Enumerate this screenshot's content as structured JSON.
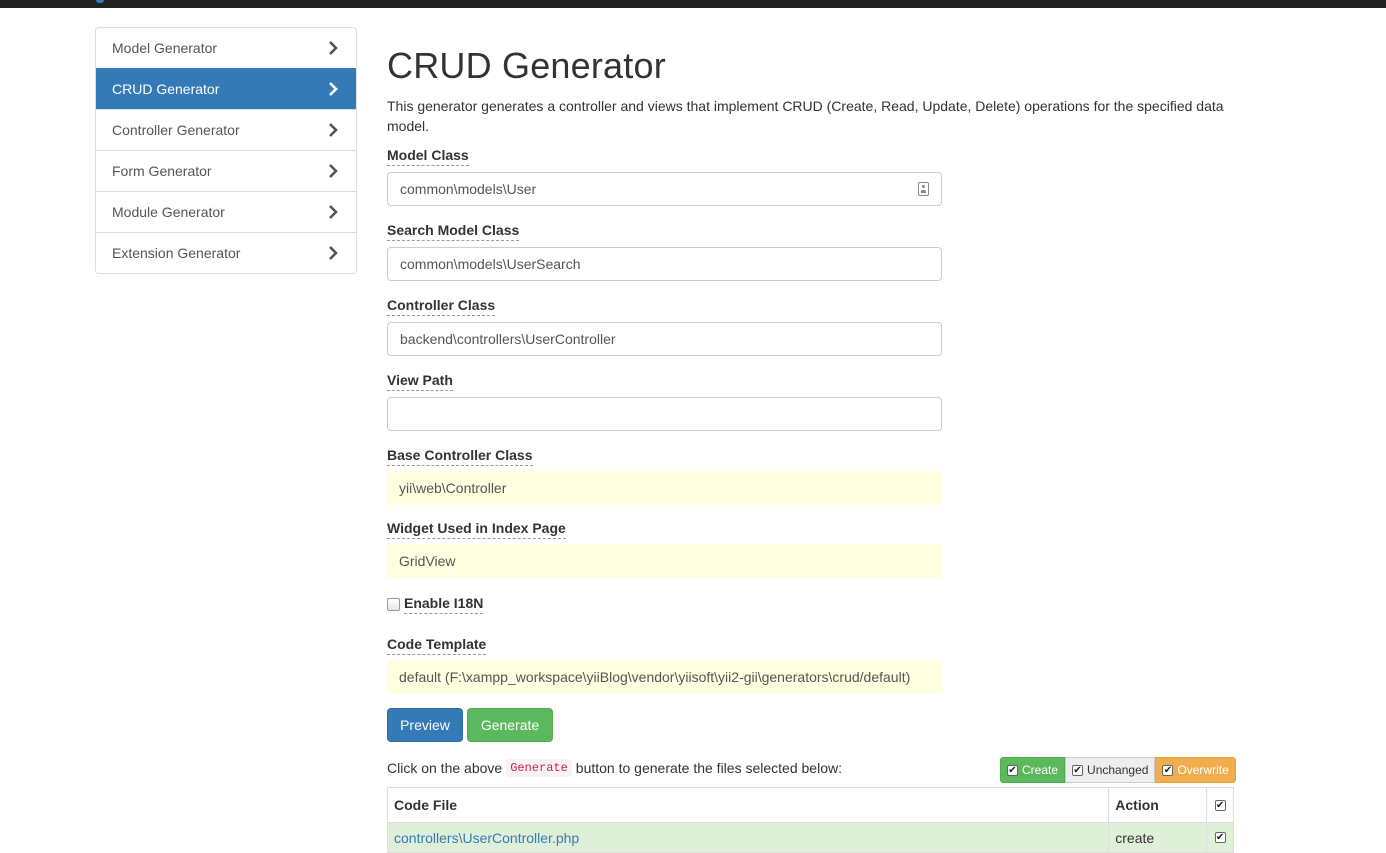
{
  "sidebar": {
    "items": [
      {
        "label": "Model Generator"
      },
      {
        "label": "CRUD Generator"
      },
      {
        "label": "Controller Generator"
      },
      {
        "label": "Form Generator"
      },
      {
        "label": "Module Generator"
      },
      {
        "label": "Extension Generator"
      }
    ],
    "active_index": 1
  },
  "main": {
    "title": "CRUD Generator",
    "description": "This generator generates a controller and views that implement CRUD (Create, Read, Update, Delete) operations for the specified data model.",
    "fields": {
      "model_class": {
        "label": "Model Class",
        "value": "common\\models\\User"
      },
      "search_model_class": {
        "label": "Search Model Class",
        "value": "common\\models\\UserSearch"
      },
      "controller_class": {
        "label": "Controller Class",
        "value": "backend\\controllers\\UserController"
      },
      "view_path": {
        "label": "View Path",
        "value": ""
      },
      "base_controller_class": {
        "label": "Base Controller Class",
        "value": "yii\\web\\Controller"
      },
      "widget": {
        "label": "Widget Used in Index Page",
        "value": "GridView"
      },
      "enable_i18n": {
        "label": "Enable I18N",
        "checked": false
      },
      "code_template": {
        "label": "Code Template",
        "value": "default (F:\\xampp_workspace\\yiiBlog\\vendor\\yiisoft\\yii2-gii\\generators\\crud/default)"
      }
    },
    "buttons": {
      "preview": "Preview",
      "generate": "Generate"
    },
    "hint": {
      "before": "Click on the above",
      "code": "Generate",
      "after": "button to generate the files selected below:"
    },
    "legend": {
      "create": "Create",
      "unchanged": "Unchanged",
      "overwrite": "Overwrite"
    },
    "table": {
      "headers": {
        "file": "Code File",
        "action": "Action"
      },
      "rows": [
        {
          "file": "controllers\\UserController.php",
          "action": "create",
          "checked": true
        }
      ]
    }
  },
  "colors": {
    "primary": "#337ab7",
    "success": "#5cb85c",
    "warning": "#f0ad4e",
    "sticky_bg": "#ffffe0",
    "row_create_bg": "#dff0d8"
  }
}
